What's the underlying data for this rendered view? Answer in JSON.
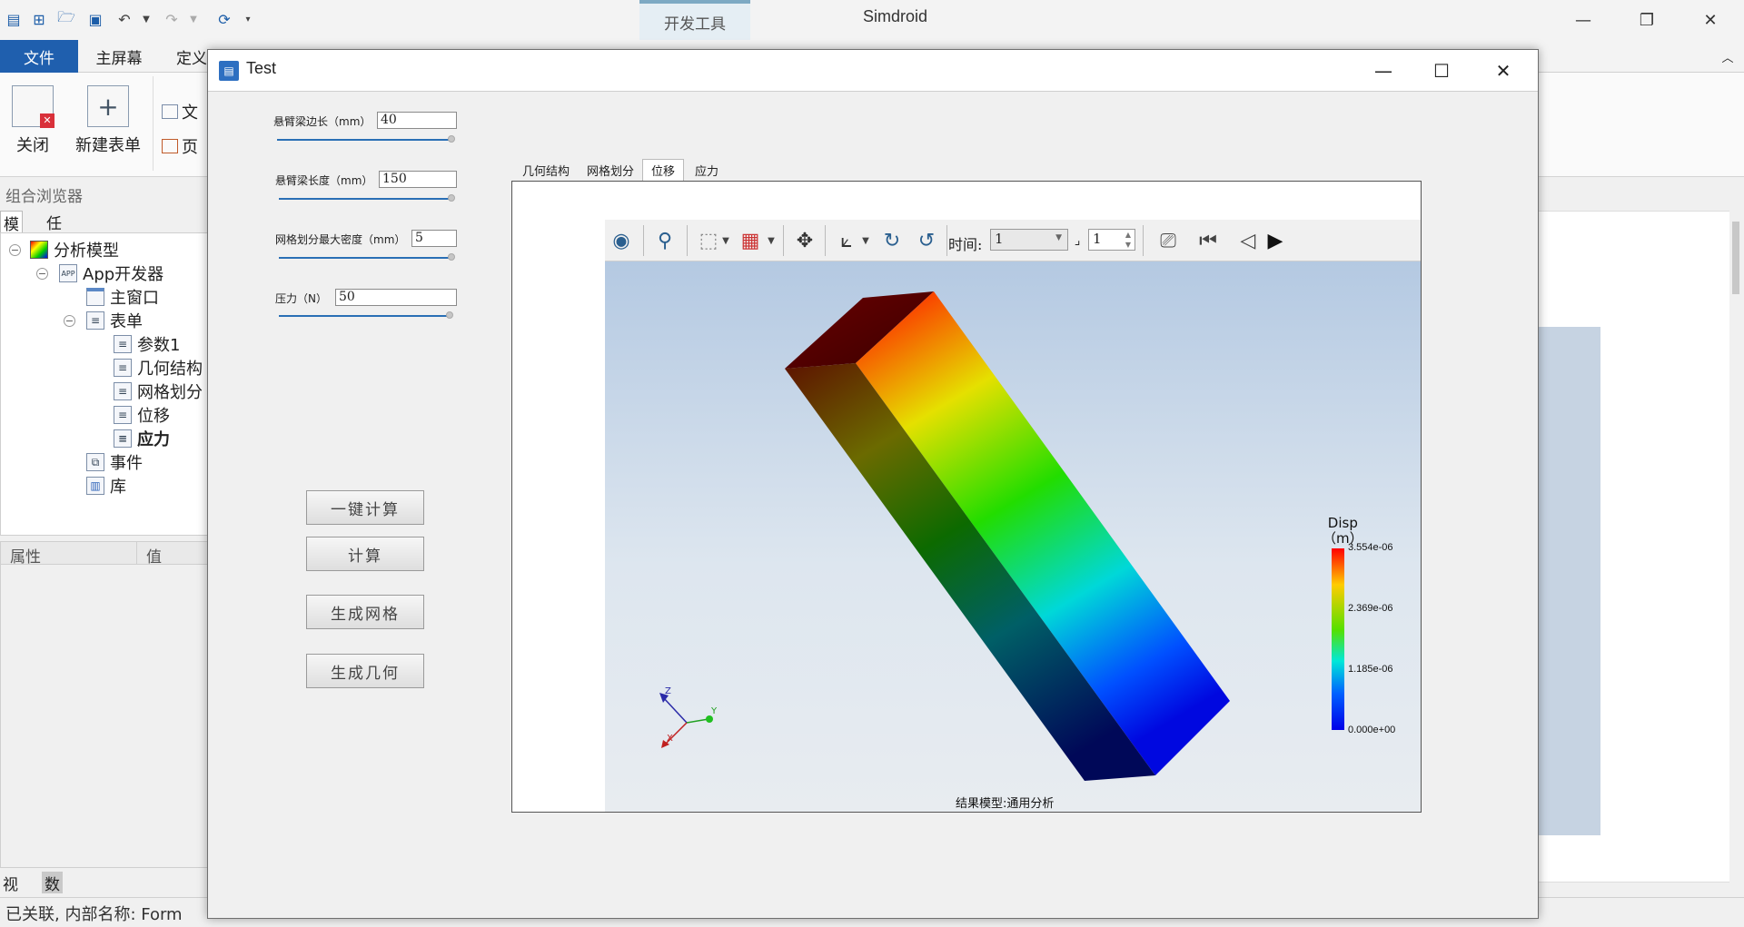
{
  "app": {
    "title": "Simdroid",
    "context_tab": "开发工具"
  },
  "ribbon": {
    "tabs": [
      "文件",
      "主屏幕",
      "定义"
    ],
    "buttons": {
      "close": "关闭",
      "new_form": "新建表单",
      "file_cut": "文",
      "page_cut": "页"
    }
  },
  "browser": {
    "title": "组合浏览器",
    "tabs": [
      "模型",
      "任务"
    ],
    "tree": [
      {
        "label": "分析模型",
        "icon": "analysis-model-icon"
      },
      {
        "label": "App开发器",
        "icon": "app-dev-icon"
      },
      {
        "label": "主窗口",
        "icon": "window-icon"
      },
      {
        "label": "表单",
        "icon": "form-icon"
      },
      {
        "label": "参数1",
        "icon": "form-page-icon"
      },
      {
        "label": "几何结构",
        "icon": "form-page-icon"
      },
      {
        "label": "网格划分",
        "icon": "form-page-icon"
      },
      {
        "label": "位移",
        "icon": "form-page-icon"
      },
      {
        "label": "应力",
        "icon": "form-page-icon"
      },
      {
        "label": "事件",
        "icon": "event-icon"
      },
      {
        "label": "库",
        "icon": "library-icon"
      }
    ]
  },
  "props": {
    "col_property": "属性",
    "col_value": "值"
  },
  "bottom_tabs": [
    "视图",
    "数据"
  ],
  "status": {
    "text": "已关联, 内部名称: Form"
  },
  "dialog": {
    "title": "Test",
    "params": [
      {
        "label": "悬臂梁边长（mm）",
        "value": "40"
      },
      {
        "label": "悬臂梁长度（mm）",
        "value": "150"
      },
      {
        "label": "网格划分最大密度（mm）",
        "value": "5"
      },
      {
        "label": "压力（N）",
        "value": "50"
      }
    ],
    "buttons": {
      "one_click": "一键计算",
      "compute": "计算",
      "gen_mesh": "生成网格",
      "gen_geom": "生成几何"
    },
    "view_tabs": [
      "几何结构",
      "网格划分",
      "位移",
      "应力"
    ],
    "active_view_tab": "位移"
  },
  "viewer": {
    "time_label": "时间:",
    "time_value": "1",
    "frame_value": "1",
    "legend": {
      "title": "Disp",
      "unit": "（m）",
      "ticks": [
        "3.554e-06",
        "2.369e-06",
        "1.185e-06",
        "0.000e+00"
      ]
    },
    "result_caption": "结果模型:通用分析",
    "axes": {
      "x": "X",
      "y": "Y",
      "z": "Z"
    }
  }
}
